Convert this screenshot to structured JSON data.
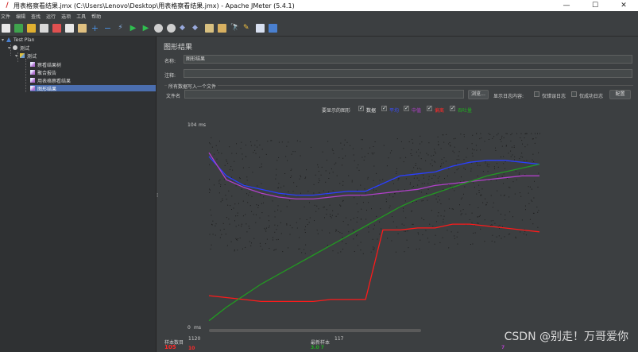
{
  "window": {
    "title": "用表格察看结果.jmx (C:\\Users\\Lenovo\\Desktop\\用表格察看结果.jmx) - Apache JMeter (5.4.1)",
    "min": "—",
    "max": "☐",
    "close": "✕"
  },
  "menu": [
    "文件",
    "编辑",
    "查找",
    "运行",
    "选项",
    "工具",
    "帮助"
  ],
  "toolbar_icons": [
    "new-icon",
    "templates-icon",
    "open-icon",
    "save-icon",
    "cut-icon",
    "copy-icon",
    "paste-icon",
    "expand-icon",
    "collapse-icon",
    "toggle-icon",
    "start-icon",
    "start-no-pause-icon",
    "stop-icon",
    "shutdown-icon",
    "remote-start-icon",
    "remote-stop-icon",
    "clear-icon",
    "clear-all-icon",
    "search-icon",
    "reset-search-icon",
    "function-helper-icon",
    "help-icon"
  ],
  "tree": {
    "items": [
      {
        "label": "Test Plan",
        "name": "tree-item-test-plan"
      },
      {
        "label": "测试",
        "name": "tree-item-thread-group"
      },
      {
        "label": "测试",
        "name": "tree-item-sampler"
      },
      {
        "label": "察看结果树",
        "name": "tree-item-view-results-tree"
      },
      {
        "label": "聚合报告",
        "name": "tree-item-aggregate-report"
      },
      {
        "label": "用表格察看结果",
        "name": "tree-item-view-results-table"
      },
      {
        "label": "图形结果",
        "name": "tree-item-graph-results"
      }
    ]
  },
  "panel": {
    "title": "图形结果",
    "name_label": "名称:",
    "name_value": "图形结果",
    "comment_label": "注释:",
    "comment_value": "",
    "group_title": "所有数据写入一个文件",
    "filename_label": "文件名",
    "filename_value": "",
    "browse_label": "浏览...",
    "log_display_label": "显示日志内容:",
    "errors_only_label": "仅错误日志",
    "success_only_label": "仅成功日志",
    "configure_label": "配置"
  },
  "legend": {
    "prefix": "要显示的图形",
    "items": [
      {
        "label": "数据",
        "color": "#333333",
        "checked": true
      },
      {
        "label": "平均",
        "color": "#3333ff",
        "checked": true
      },
      {
        "label": "中值",
        "color": "#9933cc",
        "checked": true
      },
      {
        "label": "偏离",
        "color": "#ff2222",
        "checked": true
      },
      {
        "label": "吞吐量",
        "color": "#22aa22",
        "checked": true
      }
    ]
  },
  "chart": {
    "y_max_label": "104",
    "y_min_label": "0",
    "y_unit": "ms",
    "colors": {
      "data": "#222222",
      "average": "#2a3fff",
      "median": "#b040c8",
      "deviation": "#ff1a1a",
      "throughput": "#229922"
    }
  },
  "stats": {
    "samples_label": "样本数目",
    "samples_value": "1120",
    "last_sample_label": "最新样本",
    "last_sample_value": "117",
    "left_color_value": "105",
    "left_color_value2": "10",
    "mid_values": "3.0  7",
    "right_value": "7"
  },
  "watermark": "CSDN @别走！万哥爱你",
  "chart_data": {
    "type": "line",
    "y_axis": {
      "label": "ms",
      "min": 0,
      "max": 104
    },
    "series": [
      {
        "name": "平均",
        "color": "#2a3fff",
        "values": [
          88,
          78,
          73,
          71,
          69,
          68,
          68,
          69,
          70,
          70,
          74,
          78,
          79,
          80,
          83,
          85,
          86,
          86,
          85,
          84
        ]
      },
      {
        "name": "中值",
        "color": "#b040c8",
        "values": [
          90,
          76,
          72,
          69,
          67,
          66,
          66,
          67,
          68,
          68,
          69,
          70,
          71,
          73,
          74,
          75,
          76,
          77,
          78,
          78
        ]
      },
      {
        "name": "偏离",
        "color": "#ff1a1a",
        "values": [
          16,
          15,
          14,
          13,
          13,
          13,
          13,
          14,
          14,
          14,
          50,
          50,
          51,
          51,
          53,
          53,
          52,
          51,
          50,
          49
        ]
      },
      {
        "name": "吞吐量",
        "color": "#229922",
        "values": [
          3,
          10,
          16,
          22,
          27,
          32,
          37,
          42,
          47,
          52,
          57,
          62,
          66,
          69,
          72,
          75,
          78,
          80,
          82,
          84
        ]
      }
    ]
  }
}
